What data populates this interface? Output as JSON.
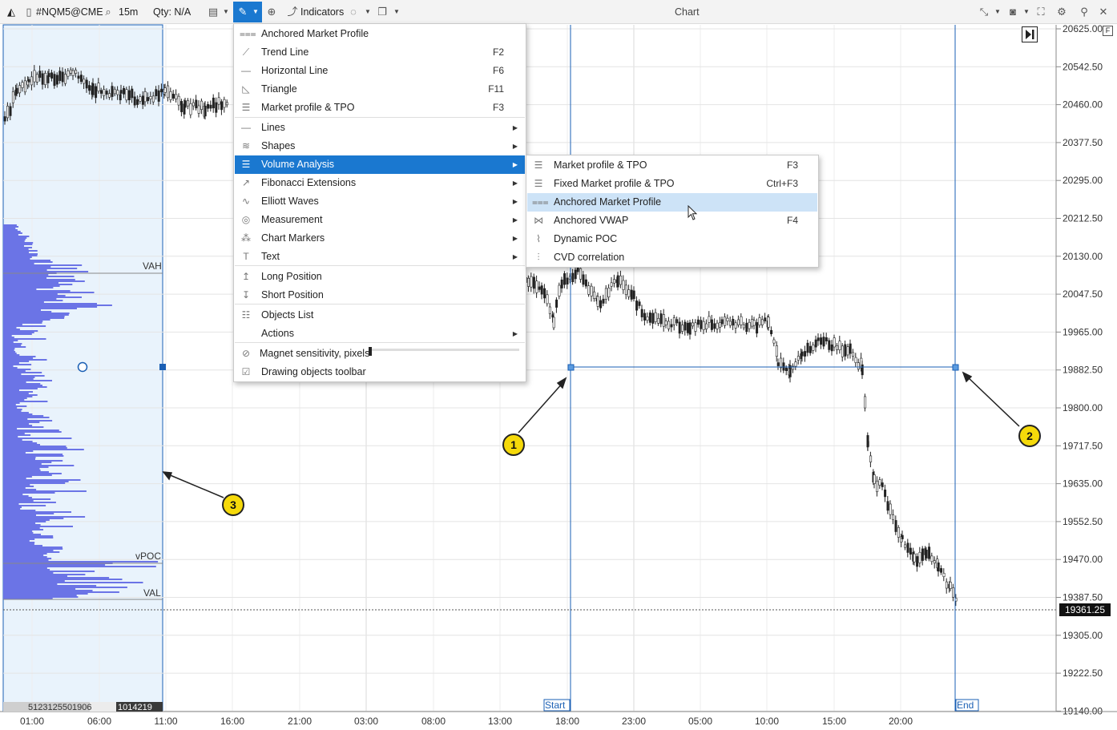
{
  "toolbar": {
    "symbol": "#NQM5@CME",
    "timeframe": "15m",
    "qty": "Qty: N/A",
    "indicators": "Indicators",
    "chart_title": "Chart"
  },
  "chart": {
    "price_labels": [
      "20625.00",
      "20542.50",
      "20460.00",
      "20377.50",
      "20295.00",
      "20212.50",
      "20130.00",
      "20047.50",
      "19965.00",
      "19882.50",
      "19800.00",
      "19717.50",
      "19635.00",
      "19552.50",
      "19470.00",
      "19387.50",
      "19305.00",
      "19222.50",
      "19140.00"
    ],
    "current_price": "19361.25",
    "time_labels": [
      "01:00",
      "06:00",
      "11:00",
      "16:00",
      "21:00",
      "03:00",
      "08:00",
      "13:00",
      "18:00",
      "23:00",
      "05:00",
      "10:00",
      "15:00",
      "20:00"
    ],
    "profile_labels": {
      "vah": "VAH",
      "vpoc": "vPOC",
      "val": "VAL"
    },
    "profile_footer": {
      "left": "5123125501906",
      "right": "1014219"
    },
    "anchor_start": "Start",
    "anchor_end": "End"
  },
  "main_menu": {
    "items": [
      {
        "label": "Anchored Market Profile",
        "shortcut": "",
        "sub": false,
        "icon": "anchored-profile-icon"
      },
      {
        "label": "Trend Line",
        "shortcut": "F2",
        "sub": false,
        "icon": "trend-line-icon"
      },
      {
        "label": "Horizontal Line",
        "shortcut": "F6",
        "sub": false,
        "icon": "horizontal-line-icon"
      },
      {
        "label": "Triangle",
        "shortcut": "F11",
        "sub": false,
        "icon": "triangle-icon"
      },
      {
        "label": "Market profile & TPO",
        "shortcut": "F3",
        "sub": false,
        "icon": "market-profile-icon"
      },
      {
        "label": "Lines",
        "shortcut": "",
        "sub": true,
        "icon": "lines-icon"
      },
      {
        "label": "Shapes",
        "shortcut": "",
        "sub": true,
        "icon": "shapes-icon"
      },
      {
        "label": "Volume Analysis",
        "shortcut": "",
        "sub": true,
        "icon": "volume-analysis-icon"
      },
      {
        "label": "Fibonacci Extensions",
        "shortcut": "",
        "sub": true,
        "icon": "fibonacci-icon"
      },
      {
        "label": "Elliott Waves",
        "shortcut": "",
        "sub": true,
        "icon": "elliott-waves-icon"
      },
      {
        "label": "Measurement",
        "shortcut": "",
        "sub": true,
        "icon": "measurement-icon"
      },
      {
        "label": "Chart Markers",
        "shortcut": "",
        "sub": true,
        "icon": "chart-markers-icon"
      },
      {
        "label": "Text",
        "shortcut": "",
        "sub": true,
        "icon": "text-icon"
      },
      {
        "label": "Long Position",
        "shortcut": "",
        "sub": false,
        "icon": "long-position-icon"
      },
      {
        "label": "Short Position",
        "shortcut": "",
        "sub": false,
        "icon": "short-position-icon"
      },
      {
        "label": "Objects List",
        "shortcut": "",
        "sub": false,
        "icon": "objects-list-icon"
      },
      {
        "label": "Actions",
        "shortcut": "",
        "sub": true,
        "icon": ""
      },
      {
        "label": "Magnet sensitivity, pixels",
        "shortcut": "",
        "sub": false,
        "icon": "magnet-icon"
      },
      {
        "label": "Drawing objects toolbar",
        "shortcut": "",
        "sub": false,
        "icon": "checkbox-icon"
      }
    ]
  },
  "sub_menu": {
    "items": [
      {
        "label": "Market profile & TPO",
        "shortcut": "F3",
        "icon": "market-profile-icon"
      },
      {
        "label": "Fixed Market profile & TPO",
        "shortcut": "Ctrl+F3",
        "icon": "fixed-profile-icon"
      },
      {
        "label": "Anchored Market Profile",
        "shortcut": "",
        "icon": "anchored-profile-icon"
      },
      {
        "label": "Anchored VWAP",
        "shortcut": "F4",
        "icon": "anchored-vwap-icon"
      },
      {
        "label": "Dynamic POC",
        "shortcut": "",
        "icon": "dynamic-poc-icon"
      },
      {
        "label": "CVD correlation",
        "shortcut": "",
        "icon": "cvd-icon"
      }
    ]
  },
  "callouts": [
    "1",
    "2",
    "3"
  ]
}
